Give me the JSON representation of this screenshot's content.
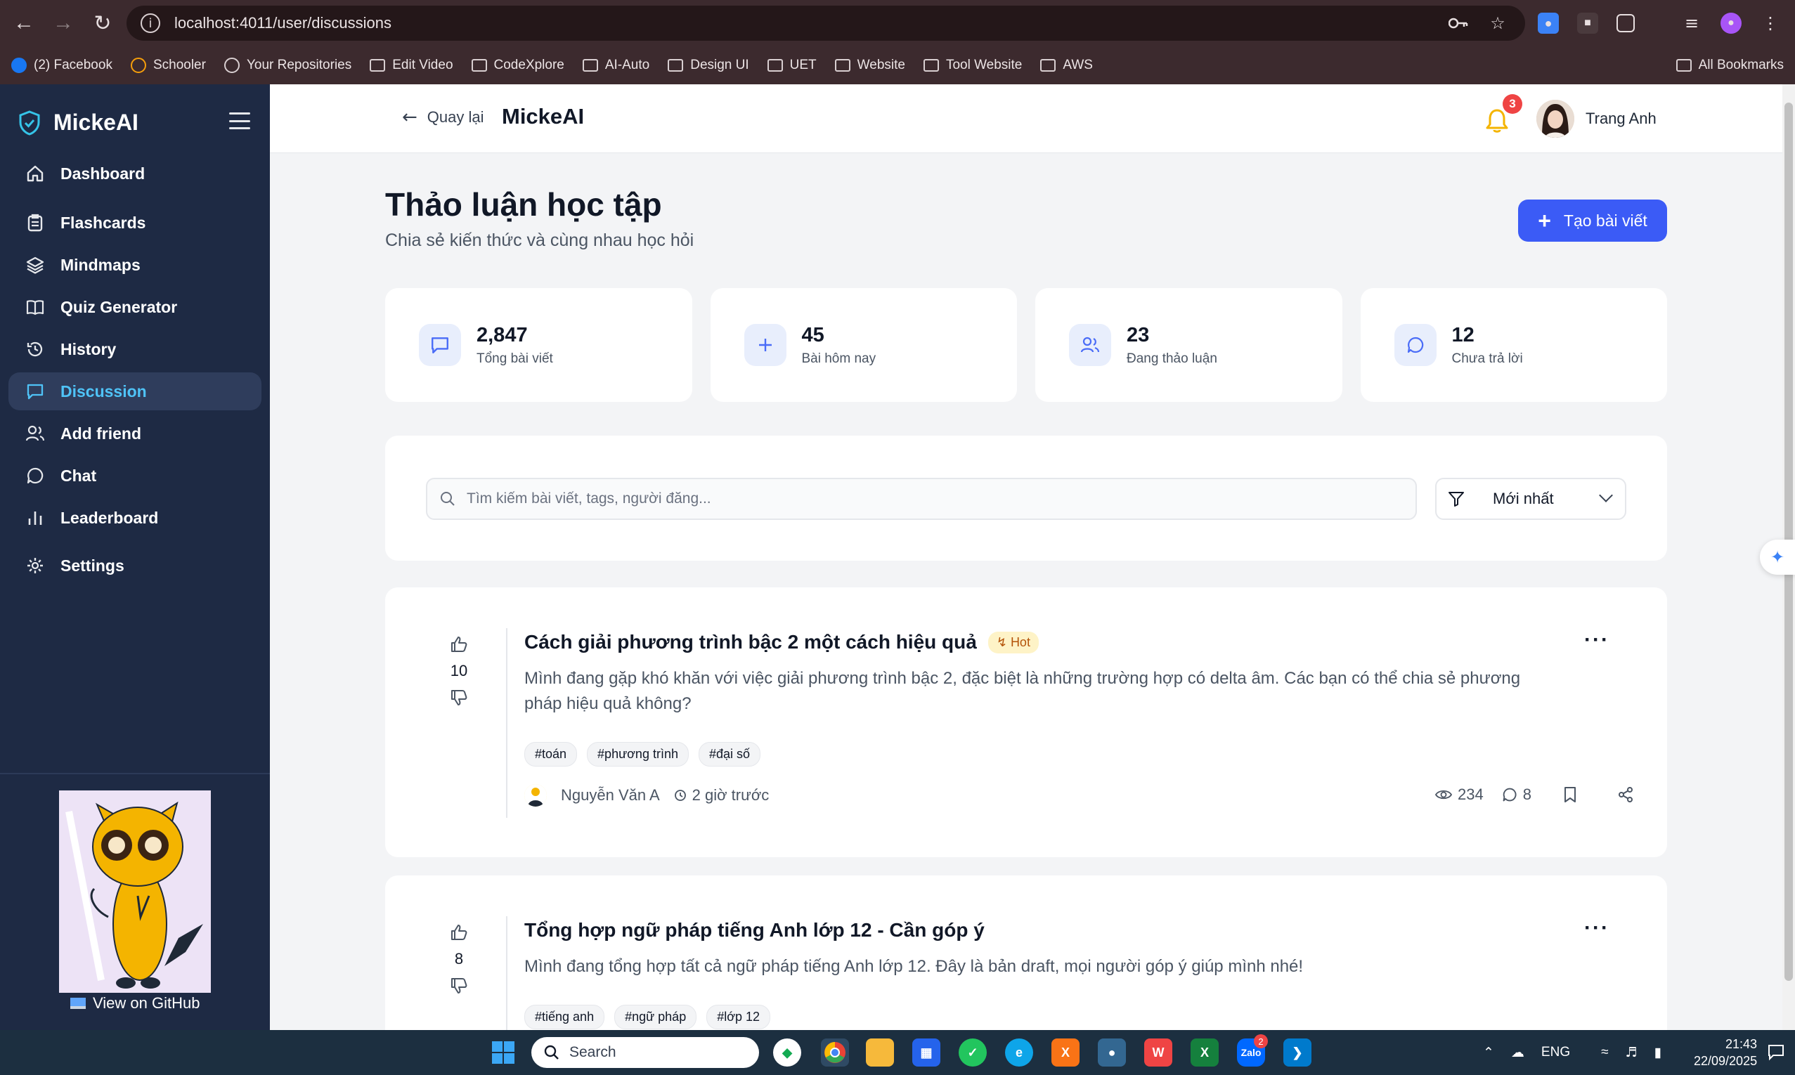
{
  "browser": {
    "url": "localhost:4011/user/discussions",
    "bookmarks": [
      "(2) Facebook",
      "Schooler",
      "Your Repositories",
      "Edit Video",
      "CodeXplore",
      "AI-Auto",
      "Design UI",
      "UET",
      "Website",
      "Tool Website",
      "AWS"
    ],
    "all_bookmarks": "All Bookmarks"
  },
  "sidebar": {
    "brand": "MickeAI",
    "items": [
      {
        "label": "Dashboard",
        "icon": "home-icon"
      },
      {
        "label": "Flashcards",
        "icon": "clipboard-icon"
      },
      {
        "label": "Mindmaps",
        "icon": "layers-icon"
      },
      {
        "label": "Quiz Generator",
        "icon": "book-icon"
      },
      {
        "label": "History",
        "icon": "history-icon"
      },
      {
        "label": "Discussion",
        "icon": "message-square-icon",
        "active": true
      },
      {
        "label": "Add friend",
        "icon": "users-icon"
      },
      {
        "label": "Chat",
        "icon": "message-circle-icon"
      },
      {
        "label": "Leaderboard",
        "icon": "bar-chart-icon"
      },
      {
        "label": "Settings",
        "icon": "gear-icon"
      }
    ],
    "github": "View on GitHub"
  },
  "header": {
    "back": "Quay lại",
    "title": "MickeAI",
    "notifications": "3",
    "user": "Trang Anh"
  },
  "page": {
    "title": "Thảo luận học tập",
    "subtitle": "Chia sẻ kiến thức và cùng nhau học hỏi",
    "create_button": "Tạo bài viết"
  },
  "stats": [
    {
      "value": "2,847",
      "label": "Tổng bài viết"
    },
    {
      "value": "45",
      "label": "Bài hôm nay"
    },
    {
      "value": "23",
      "label": "Đang thảo luận"
    },
    {
      "value": "12",
      "label": "Chưa trả lời"
    }
  ],
  "filters": {
    "search_placeholder": "Tìm kiếm bài viết, tags, người đăng...",
    "sort": "Mới nhất"
  },
  "posts": [
    {
      "votes": "10",
      "title": "Cách giải phương trình bậc 2 một cách hiệu quả",
      "badge": "Hot",
      "body": "Mình đang gặp khó khăn với việc giải phương trình bậc 2, đặc biệt là những trường hợp có delta âm. Các bạn có thể chia sẻ phương pháp hiệu quả không?",
      "tags": [
        "#toán",
        "#phương trình",
        "#đại số"
      ],
      "author": "Nguyễn Văn A",
      "time": "2 giờ trước",
      "views": "234",
      "comments": "8"
    },
    {
      "votes": "8",
      "title": "Tổng hợp ngữ pháp tiếng Anh lớp 12 - Cần góp ý",
      "body": "Mình đang tổng hợp tất cả ngữ pháp tiếng Anh lớp 12. Đây là bản draft, mọi người góp ý giúp mình nhé!",
      "tags": [
        "#tiếng anh",
        "#ngữ pháp",
        "#lớp 12"
      ]
    }
  ],
  "taskbar": {
    "search": "Search",
    "lang": "ENG",
    "time": "21:43",
    "date": "22/09/2025",
    "zalo_badge": "2"
  }
}
